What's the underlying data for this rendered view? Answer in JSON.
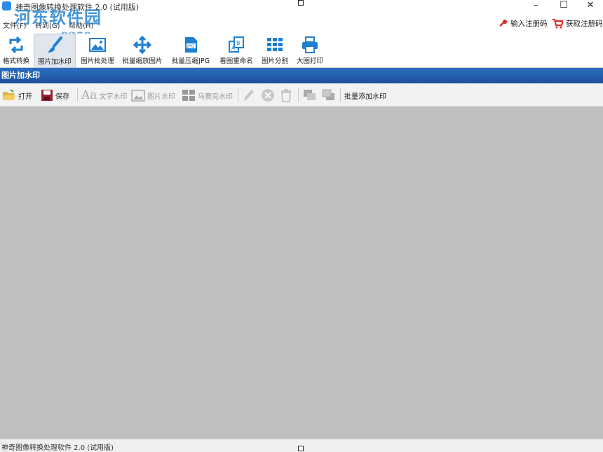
{
  "app": {
    "title": "神奇图像转换处理软件 2.0 (试用版)"
  },
  "watermark": {
    "site": "河东软件园",
    "url": "www.pc0359.cn"
  },
  "window": {
    "minimize": "–",
    "maximize": "☐",
    "close": "✕"
  },
  "menu": {
    "items": [
      "文件(F)",
      "转到(G)",
      "帮助(H)"
    ]
  },
  "register": {
    "enter_code": "输入注册码",
    "get_code": "获取注册码"
  },
  "ribbon": {
    "items": [
      {
        "label": "格式转换",
        "icon": "format-convert-icon"
      },
      {
        "label": "图片加水印",
        "icon": "watermark-brush-icon"
      },
      {
        "label": "图片批处理",
        "icon": "image-batch-icon"
      },
      {
        "label": "批量缩放图片",
        "icon": "resize-arrows-icon"
      },
      {
        "label": "批量压缩JPG",
        "icon": "jpg-compress-icon"
      },
      {
        "label": "看图重命名",
        "icon": "rename-icon"
      },
      {
        "label": "图片分割",
        "icon": "grid-split-icon"
      },
      {
        "label": "大图打印",
        "icon": "printer-icon"
      }
    ],
    "active_index": 1
  },
  "panel": {
    "title": "图片加水印"
  },
  "toolbar": {
    "open": "打开",
    "save": "保存",
    "text_wm": "文字水印",
    "image_wm": "图片水印",
    "mosaic_wm": "马赛克水印",
    "batch_add": "批量添加水印"
  },
  "status": {
    "text": "神奇图像转换处理软件 2.0 (试用版)"
  },
  "colors": {
    "accent": "#1c4f9a",
    "canvas": "#bfbfbf",
    "brand": "#2a8ee8"
  }
}
